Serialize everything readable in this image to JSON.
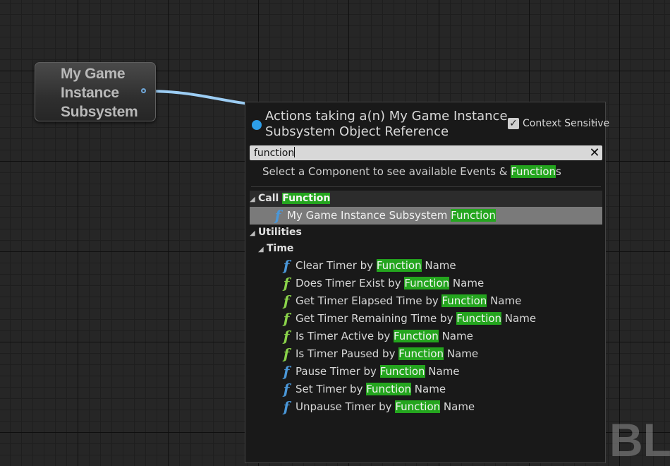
{
  "node": {
    "title": "My Game\nInstance\nSubsystem"
  },
  "menu": {
    "title": "Actions taking a(n) My Game Instance Subsystem Object Reference",
    "context_label": "Context Sensitive",
    "context_checked": true,
    "search": {
      "value": "function"
    },
    "hint": {
      "before": "Select a Component to see available Events & ",
      "highlight": "Function",
      "after": "s"
    },
    "categories": [
      {
        "name_before": "Call ",
        "name_highlight": "Function",
        "items": [
          {
            "before": "My Game Instance Subsystem ",
            "highlight": "Function",
            "after": "",
            "icon": "function-blue-icon",
            "selected": true
          }
        ]
      },
      {
        "name_before": "Utilities",
        "name_highlight": ""
      },
      {
        "name_before": "Time",
        "name_highlight": "",
        "items": [
          {
            "before": "Clear Timer by ",
            "highlight": "Function",
            "after": " Name",
            "icon": "function-blue-icon"
          },
          {
            "before": "Does Timer Exist by ",
            "highlight": "Function",
            "after": " Name",
            "icon": "function-green-icon"
          },
          {
            "before": "Get Timer Elapsed Time by ",
            "highlight": "Function",
            "after": " Name",
            "icon": "function-green-icon"
          },
          {
            "before": "Get Timer Remaining Time by ",
            "highlight": "Function",
            "after": " Name",
            "icon": "function-green-icon"
          },
          {
            "before": "Is Timer Active by ",
            "highlight": "Function",
            "after": " Name",
            "icon": "function-green-icon"
          },
          {
            "before": "Is Timer Paused by ",
            "highlight": "Function",
            "after": " Name",
            "icon": "function-green-icon"
          },
          {
            "before": "Pause Timer by ",
            "highlight": "Function",
            "after": " Name",
            "icon": "function-blue-icon"
          },
          {
            "before": "Set Timer by ",
            "highlight": "Function",
            "after": " Name",
            "icon": "function-blue-icon"
          },
          {
            "before": "Unpause Timer by ",
            "highlight": "Function",
            "after": " Name",
            "icon": "function-blue-icon"
          }
        ]
      }
    ]
  },
  "watermark": "BL",
  "colors": {
    "highlight": "#24a51e",
    "pin": "#6fa7d9",
    "blue_fn": "#4a97d8",
    "green_fn": "#8ad34a"
  }
}
